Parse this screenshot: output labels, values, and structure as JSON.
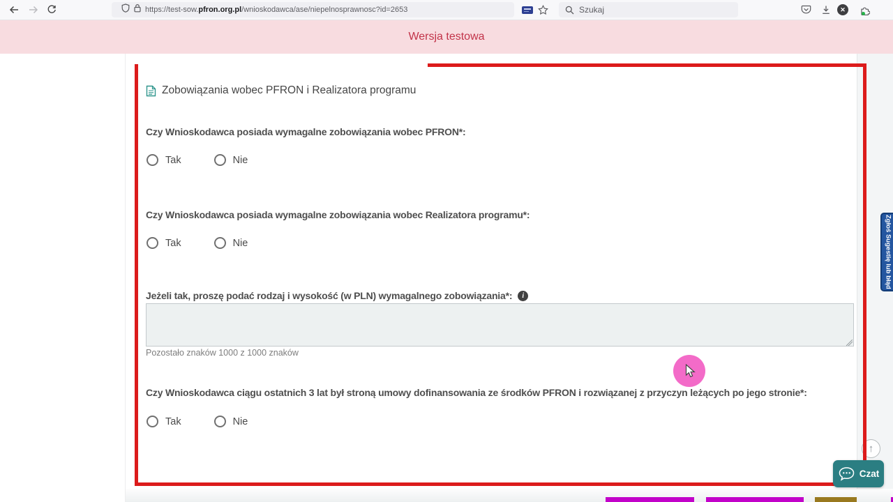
{
  "browser": {
    "url": {
      "prefix": "https://test-sow.",
      "domain": "pfron.org.pl",
      "path": "/wnioskodawca/ase/niepelnosprawnosc?id=2653"
    },
    "search": {
      "placeholder": "Szukaj"
    },
    "icons": [
      "back-icon",
      "forward-icon",
      "reload-icon",
      "shield-icon",
      "lock-icon",
      "extension-badge-icon",
      "bookmark-star-icon",
      "search-icon",
      "pocket-icon",
      "download-icon",
      "close-circle-icon",
      "puzzle-icon",
      "menu-icon"
    ]
  },
  "banner": {
    "label": "Wersja testowa"
  },
  "form": {
    "section": {
      "title": "Zobowiązania wobec PFRON i Realizatora programu",
      "icon": "document-icon"
    },
    "questions": [
      {
        "label": "Czy Wnioskodawca posiada wymagalne zobowiązania wobec PFRON*:",
        "options": [
          "Tak",
          "Nie"
        ],
        "selected": null
      },
      {
        "label": "Czy Wnioskodawca posiada wymagalne zobowiązania wobec Realizatora programu*:",
        "options": [
          "Tak",
          "Nie"
        ],
        "selected": null
      },
      {
        "label": "Czy Wnioskodawca ciągu ostatnich 3 lat był stroną umowy dofinansowania ze środków PFRON i rozwiązanej z przyczyn leżących po jego stronie*:",
        "options": [
          "Tak",
          "Nie"
        ],
        "selected": null
      }
    ],
    "textarea": {
      "label": "Jeżeli tak, proszę podać rodzaj i wysokość (w PLN) wymagalnego zobowiązania*:",
      "value": "",
      "counter": "Pozostało znaków 1000 z 1000 znaków",
      "icon": "info-icon"
    }
  },
  "widgets": {
    "side_tab": {
      "label": "Zgłoś Sugestię lub błąd"
    },
    "chat": {
      "label": "Czat",
      "icon": "chat-bubble-icon"
    },
    "scroll_top": {
      "icon": "arrow-up-icon"
    }
  },
  "colors": {
    "highlight_red": "#dc1b1b",
    "banner_bg": "#f8dce0",
    "banner_text": "#c23349",
    "teal_accent": "#2b7e82",
    "tab_blue": "#2456a0",
    "cursor_pink": "#f25ec3",
    "magenta_button": "#c203c9",
    "gold_button": "#99791f"
  }
}
